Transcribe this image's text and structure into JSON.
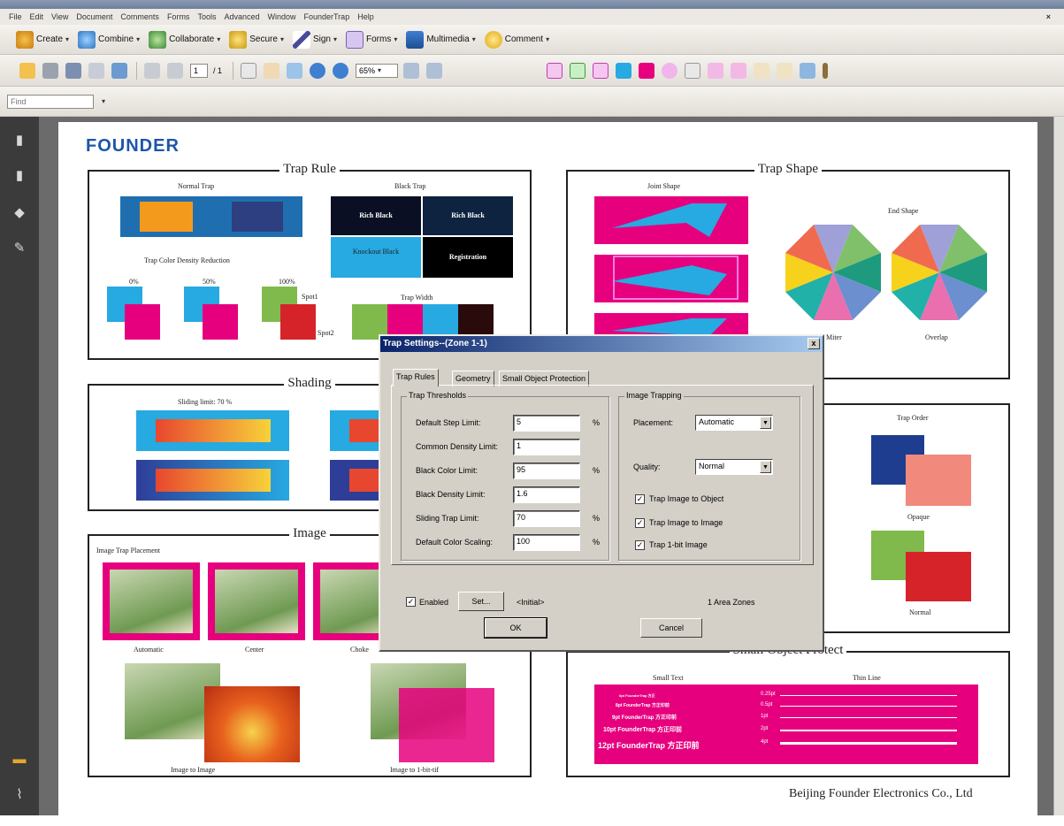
{
  "menu": [
    "File",
    "Edit",
    "View",
    "Document",
    "Comments",
    "Forms",
    "Tools",
    "Advanced",
    "Window",
    "FounderTrap",
    "Help"
  ],
  "toolbar1": [
    {
      "label": "Create",
      "icon": "create-icon"
    },
    {
      "label": "Combine",
      "icon": "combine-icon"
    },
    {
      "label": "Collaborate",
      "icon": "collaborate-icon"
    },
    {
      "label": "Secure",
      "icon": "lock-icon"
    },
    {
      "label": "Sign",
      "icon": "pen-icon"
    },
    {
      "label": "Forms",
      "icon": "forms-icon"
    },
    {
      "label": "Multimedia",
      "icon": "multimedia-icon"
    },
    {
      "label": "Comment",
      "icon": "comment-icon"
    }
  ],
  "nav": {
    "page_current": "1",
    "page_total": "/ 1",
    "zoom": "65%"
  },
  "find": {
    "placeholder": "Find"
  },
  "document": {
    "logo": "FOUNDER",
    "footer": "Beijing Founder Electronics Co., Ltd",
    "trap_rule": {
      "title": "Trap Rule",
      "normal_trap": "Normal Trap",
      "black_trap": "Black Trap",
      "rich_black_1": "Rich Black",
      "rich_black_2": "Rich Black",
      "knockout_black": "Knockout Black",
      "registration": "Registration",
      "density_reduction": "Trap Color Density Reduction",
      "pct_0": "0%",
      "pct_50": "50%",
      "pct_100": "100%",
      "spot1": "Spot1",
      "spot2": "Spot2",
      "trap_width": "Trap Width"
    },
    "shading": {
      "title": "Shading",
      "sliding_limit": "Sliding limit: 70 %"
    },
    "image": {
      "title": "Image",
      "placement": "Image Trap Placement",
      "automatic": "Automatic",
      "center": "Center",
      "choke": "Choke",
      "image_to_image": "Image to Image",
      "image_to_1bit": "Image to 1-bit-tif"
    },
    "trap_shape": {
      "title": "Trap Shape",
      "joint_shape": "Joint Shape",
      "end_shape": "End Shape",
      "miter": "Miter",
      "overlap": "Overlap"
    },
    "trap_order": {
      "title": "Trap Order",
      "opaque": "Opaque",
      "normal": "Normal"
    },
    "small_object": {
      "title": "Small Object Protect",
      "small_text": "Small Text",
      "thin_line": "Thin Line",
      "text_lines": [
        "6pt FounderTrap 方正",
        "8pt FounderTrap 方正印前",
        "9pt FounderTrap 方正印前",
        "10pt FounderTrap 方正印前",
        "12pt FounderTrap 方正印前"
      ],
      "line_labels": [
        "0.25pt",
        "0.5pt",
        "1pt",
        "2pt",
        "4pt"
      ]
    }
  },
  "dialog": {
    "title": "Trap Settings--(Zone 1-1)",
    "close": "x",
    "tabs": [
      "Trap Rules",
      "Geometry",
      "Small Object Protection"
    ],
    "thresholds": {
      "group": "Trap Thresholds",
      "rows": [
        {
          "label": "Default Step Limit:",
          "value": "5",
          "unit": "%"
        },
        {
          "label": "Common Density Limit:",
          "value": "1",
          "unit": ""
        },
        {
          "label": "Black Color Limit:",
          "value": "95",
          "unit": "%"
        },
        {
          "label": "Black Density Limit:",
          "value": "1.6",
          "unit": ""
        },
        {
          "label": "Sliding Trap Limit:",
          "value": "70",
          "unit": "%"
        },
        {
          "label": "Default Color Scaling:",
          "value": "100",
          "unit": "%"
        }
      ]
    },
    "image_trapping": {
      "group": "Image Trapping",
      "placement_label": "Placement:",
      "placement_value": "Automatic",
      "quality_label": "Quality:",
      "quality_value": "Normal",
      "checks": [
        {
          "label": "Trap Image to Object",
          "checked": true
        },
        {
          "label": "Trap Image to Image",
          "checked": true
        },
        {
          "label": "Trap 1-bit Image",
          "checked": true
        }
      ]
    },
    "enabled_label": "Enabled",
    "set_button": "Set...",
    "initial": "<Initial>",
    "zones": "1 Area Zones",
    "ok": "OK",
    "cancel": "Cancel"
  }
}
